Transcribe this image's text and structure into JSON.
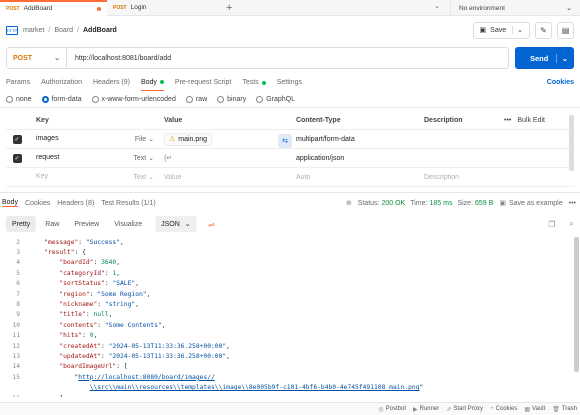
{
  "tabs": [
    {
      "method": "POST",
      "label": "AddBoard"
    },
    {
      "method": "POST",
      "label": "Login"
    }
  ],
  "environment": "No environment",
  "breadcrumb": {
    "workspace": "market",
    "collection": "Board",
    "current": "AddBoard"
  },
  "save_label": "Save",
  "request": {
    "method": "POST",
    "url": "http://localhost:8081/board/add",
    "send_label": "Send"
  },
  "request_tabs": [
    "Params",
    "Authorization",
    "Headers (9)",
    "Body",
    "Pre-request Script",
    "Tests",
    "Settings"
  ],
  "cookies_label": "Cookies",
  "body_types": [
    "none",
    "form-data",
    "x-www-form-urlencoded",
    "raw",
    "binary",
    "GraphQL"
  ],
  "form_table": {
    "headers": {
      "key": "Key",
      "value": "Value",
      "content_type": "Content-Type",
      "description": "Description",
      "bulk_edit": "Bulk Edit"
    },
    "rows": [
      {
        "key": "images",
        "type": "File",
        "value": "main.png",
        "content_type": "multipart/form-data"
      },
      {
        "key": "request",
        "type": "Text",
        "value": "{↵",
        "content_type": "application/json"
      }
    ],
    "placeholder": {
      "key": "Key",
      "type": "Text",
      "value": "Value",
      "content_type": "Auto",
      "description": "Description"
    }
  },
  "response_tabs": [
    "Body",
    "Cookies",
    "Headers (8)",
    "Test Results (1/1)"
  ],
  "status": {
    "status_label": "Status:",
    "status": "200 OK",
    "time_label": "Time:",
    "time": "185 ms",
    "size_label": "Size:",
    "size": "659 B"
  },
  "save_example_label": "Save as example",
  "view_tabs": [
    "Pretty",
    "Raw",
    "Preview",
    "Visualize"
  ],
  "format": "JSON",
  "code_lines": [
    {
      "n": "2",
      "indent": "    ",
      "tokens": [
        {
          "c": "k",
          "t": "\"message\""
        },
        {
          "c": "",
          "t": ": "
        },
        {
          "c": "s",
          "t": "\"Success\""
        },
        {
          "c": "",
          "t": ","
        }
      ]
    },
    {
      "n": "3",
      "indent": "    ",
      "tokens": [
        {
          "c": "k",
          "t": "\"result\""
        },
        {
          "c": "",
          "t": ": {"
        }
      ]
    },
    {
      "n": "4",
      "indent": "        ",
      "tokens": [
        {
          "c": "k",
          "t": "\"boardId\""
        },
        {
          "c": "",
          "t": ": "
        },
        {
          "c": "n",
          "t": "3640"
        },
        {
          "c": "",
          "t": ","
        }
      ]
    },
    {
      "n": "5",
      "indent": "        ",
      "tokens": [
        {
          "c": "k",
          "t": "\"categoryId\""
        },
        {
          "c": "",
          "t": ": "
        },
        {
          "c": "n",
          "t": "1"
        },
        {
          "c": "",
          "t": ","
        }
      ]
    },
    {
      "n": "6",
      "indent": "        ",
      "tokens": [
        {
          "c": "k",
          "t": "\"sortStatus\""
        },
        {
          "c": "",
          "t": ": "
        },
        {
          "c": "s",
          "t": "\"SALE\""
        },
        {
          "c": "",
          "t": ","
        }
      ]
    },
    {
      "n": "7",
      "indent": "        ",
      "tokens": [
        {
          "c": "k",
          "t": "\"region\""
        },
        {
          "c": "",
          "t": ": "
        },
        {
          "c": "s",
          "t": "\"Some Region\""
        },
        {
          "c": "",
          "t": ","
        }
      ]
    },
    {
      "n": "8",
      "indent": "        ",
      "tokens": [
        {
          "c": "k",
          "t": "\"nickname\""
        },
        {
          "c": "",
          "t": ": "
        },
        {
          "c": "s",
          "t": "\"string\""
        },
        {
          "c": "",
          "t": ","
        }
      ]
    },
    {
      "n": "9",
      "indent": "        ",
      "tokens": [
        {
          "c": "k",
          "t": "\"title\""
        },
        {
          "c": "",
          "t": ": "
        },
        {
          "c": "n",
          "t": "null"
        },
        {
          "c": "",
          "t": ","
        }
      ]
    },
    {
      "n": "10",
      "indent": "        ",
      "tokens": [
        {
          "c": "k",
          "t": "\"contents\""
        },
        {
          "c": "",
          "t": ": "
        },
        {
          "c": "s",
          "t": "\"Some Contents\""
        },
        {
          "c": "",
          "t": ","
        }
      ]
    },
    {
      "n": "11",
      "indent": "        ",
      "tokens": [
        {
          "c": "k",
          "t": "\"hits\""
        },
        {
          "c": "",
          "t": ": "
        },
        {
          "c": "n",
          "t": "0"
        },
        {
          "c": "",
          "t": ","
        }
      ]
    },
    {
      "n": "12",
      "indent": "        ",
      "tokens": [
        {
          "c": "k",
          "t": "\"createdAt\""
        },
        {
          "c": "",
          "t": ": "
        },
        {
          "c": "s",
          "t": "\"2024-05-13T11:33:36.258+00:00\""
        },
        {
          "c": "",
          "t": ","
        }
      ]
    },
    {
      "n": "13",
      "indent": "        ",
      "tokens": [
        {
          "c": "k",
          "t": "\"updatedAt\""
        },
        {
          "c": "",
          "t": ": "
        },
        {
          "c": "s",
          "t": "\"2024-05-13T11:33:36.258+00:00\""
        },
        {
          "c": "",
          "t": ","
        }
      ]
    },
    {
      "n": "14",
      "indent": "        ",
      "tokens": [
        {
          "c": "k",
          "t": "\"boardImageUrl\""
        },
        {
          "c": "",
          "t": ": ["
        }
      ]
    },
    {
      "n": "15",
      "indent": "            ",
      "tokens": [
        {
          "c": "",
          "t": "\""
        },
        {
          "c": "lnk",
          "t": "http://localhost:8080/board/images//"
        }
      ]
    },
    {
      "n": "",
      "indent": "                ",
      "tokens": [
        {
          "c": "lnk",
          "t": "\\\\src\\\\main\\\\resources\\\\templates\\\\image\\\\8e005b9f-c101-4bf6-b4b0-4e745f491108_main.png"
        },
        {
          "c": "",
          "t": "\""
        }
      ]
    },
    {
      "n": "16",
      "indent": "        ",
      "tokens": [
        {
          "c": "",
          "t": "]"
        }
      ]
    }
  ],
  "footer": [
    "Postbot",
    "Runner",
    "Start Proxy",
    "Cookies",
    "Vault",
    "Trash"
  ]
}
